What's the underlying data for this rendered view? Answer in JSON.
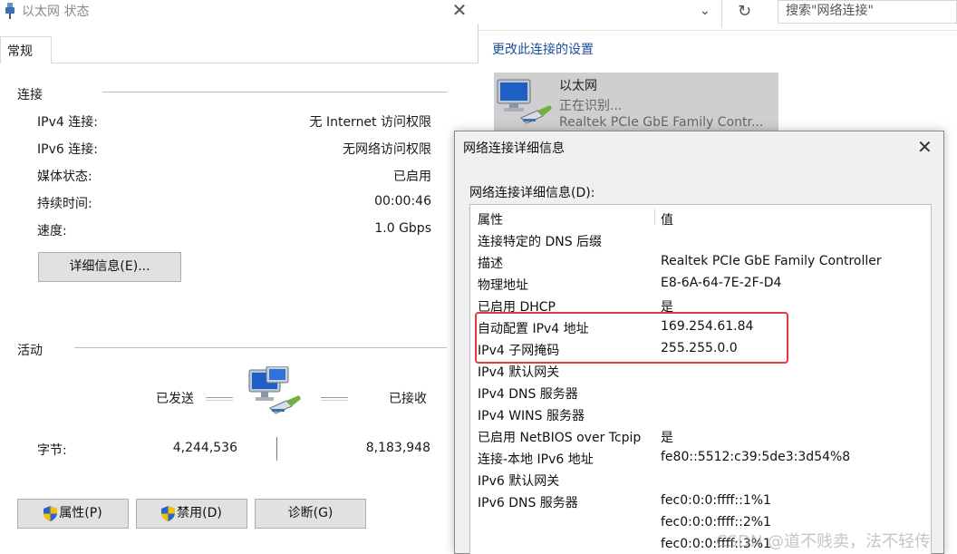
{
  "status_window": {
    "title": "以太网 状态",
    "close_glyph": "✕",
    "tab": "常规",
    "connection": {
      "heading": "连接",
      "rows": [
        {
          "label": "IPv4 连接:",
          "value": "无 Internet 访问权限"
        },
        {
          "label": "IPv6 连接:",
          "value": "无网络访问权限"
        },
        {
          "label": "媒体状态:",
          "value": "已启用"
        },
        {
          "label": "持续时间:",
          "value": "00:00:46"
        },
        {
          "label": "速度:",
          "value": "1.0 Gbps"
        }
      ],
      "details_button": "详细信息(E)..."
    },
    "activity": {
      "heading": "活动",
      "sent_label": "已发送",
      "received_label": "已接收",
      "bytes_label": "字节:",
      "bytes_sent": "4,244,536",
      "bytes_received": "8,183,948"
    },
    "buttons": {
      "properties": "属性(P)",
      "disable": "禁用(D)",
      "diagnose": "诊断(G)"
    }
  },
  "network_connections": {
    "search_placeholder": "搜索\"网络连接\"",
    "chevron_glyph": "⌄",
    "refresh_glyph": "↻",
    "command_link": "更改此连接的设置",
    "adapter": {
      "name": "以太网",
      "status": "正在识别...",
      "device": "Realtek PCIe GbE Family Contr..."
    }
  },
  "details_dialog": {
    "title": "网络连接详细信息",
    "close_glyph": "✕",
    "label": "网络连接详细信息(D):",
    "col_property": "属性",
    "col_value": "值",
    "rows": [
      {
        "property": "连接特定的 DNS 后缀",
        "value": ""
      },
      {
        "property": "描述",
        "value": "Realtek PCIe GbE Family Controller"
      },
      {
        "property": "物理地址",
        "value": "E8-6A-64-7E-2F-D4"
      },
      {
        "property": "已启用 DHCP",
        "value": "是"
      },
      {
        "property": "自动配置 IPv4 地址",
        "value": "169.254.61.84"
      },
      {
        "property": "IPv4 子网掩码",
        "value": "255.255.0.0"
      },
      {
        "property": "IPv4 默认网关",
        "value": ""
      },
      {
        "property": "IPv4 DNS 服务器",
        "value": ""
      },
      {
        "property": "IPv4 WINS 服务器",
        "value": ""
      },
      {
        "property": "已启用 NetBIOS over Tcpip",
        "value": "是"
      },
      {
        "property": "连接-本地 IPv6 地址",
        "value": "fe80::5512:c39:5de3:3d54%8"
      },
      {
        "property": "IPv6 默认网关",
        "value": ""
      },
      {
        "property": "IPv6 DNS 服务器",
        "value": "fec0:0:0:ffff::1%1"
      },
      {
        "property": "",
        "value": "fec0:0:0:ffff::2%1"
      },
      {
        "property": "",
        "value": "fec0:0:0:ffff::3%1"
      }
    ]
  },
  "watermark": "CSDN @道不贱卖，法不轻传",
  "colors": {
    "highlight": "#e8383d",
    "link": "#1b4f9c",
    "selected_adapter": "#cfcfcf"
  }
}
